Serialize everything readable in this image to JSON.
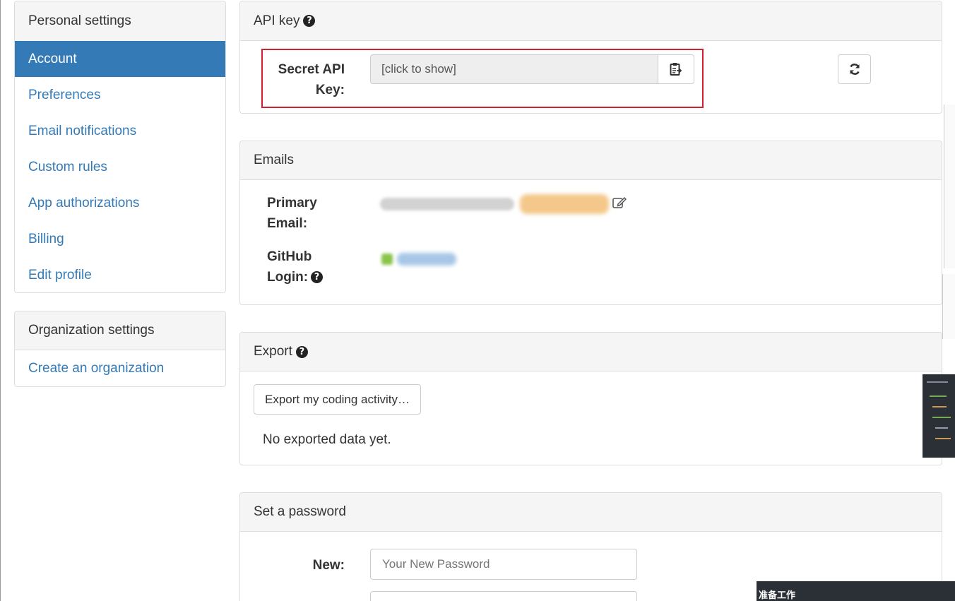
{
  "sidebar": {
    "personal_heading": "Personal settings",
    "items": [
      {
        "label": "Account",
        "active": true
      },
      {
        "label": "Preferences",
        "active": false
      },
      {
        "label": "Email notifications",
        "active": false
      },
      {
        "label": "Custom rules",
        "active": false
      },
      {
        "label": "App authorizations",
        "active": false
      },
      {
        "label": "Billing",
        "active": false
      },
      {
        "label": "Edit profile",
        "active": false
      }
    ],
    "org_heading": "Organization settings",
    "org_items": [
      {
        "label": "Create an organization"
      }
    ]
  },
  "api_key": {
    "heading": "API key",
    "help_icon": "question-circle-icon",
    "label_line1": "Secret API",
    "label_line2": "Key:",
    "value": "[click to show]",
    "copy_icon": "clipboard-icon",
    "refresh_icon": "refresh-icon"
  },
  "emails": {
    "heading": "Emails",
    "primary_label_line1": "Primary",
    "primary_label_line2": "Email:",
    "github_label_line1": "GitHub",
    "github_label_line2": "Login:",
    "edit_icon": "edit-icon"
  },
  "export": {
    "heading": "Export",
    "button_label": "Export my coding activity…",
    "status": "No exported data yet."
  },
  "password": {
    "heading": "Set a password",
    "new_label": "New:",
    "new_placeholder": "Your New Password"
  },
  "overlay": {
    "bottom_bar_text": "准备工作"
  },
  "colors": {
    "accent": "#337ab7",
    "highlight_border": "#d0202e",
    "panel_heading_bg": "#f5f5f5",
    "border": "#dddddd"
  }
}
